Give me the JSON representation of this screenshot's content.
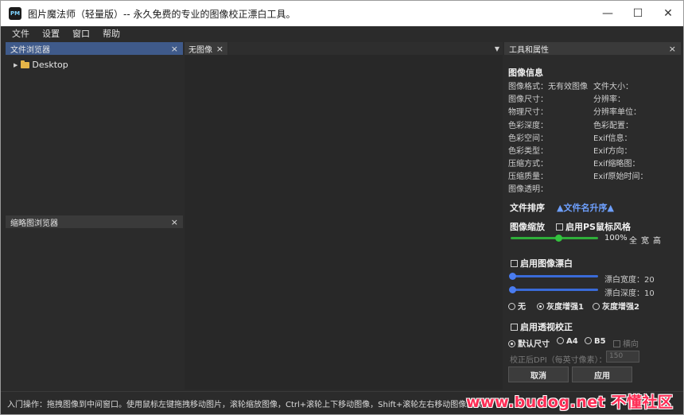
{
  "window": {
    "title": "图片魔法师（轻量版）-- 永久免费的专业的图像校正漂白工具。",
    "app_icon_text": "PM",
    "controls": {
      "minimize": "—",
      "maximize": "☐",
      "close": "✕"
    }
  },
  "menu": [
    "文件",
    "设置",
    "窗口",
    "帮助"
  ],
  "file_browser": {
    "title": "文件浏览器",
    "tree": [
      {
        "label": "Desktop",
        "icon": "folder-icon",
        "expanded": false
      }
    ]
  },
  "thumb_browser": {
    "title": "缩略图浏览器"
  },
  "editor": {
    "tab_label": "无图像"
  },
  "props": {
    "panel_title": "工具和属性",
    "info_title": "图像信息",
    "info_left": [
      "图像格式：无有效图像",
      "图像尺寸：",
      "物理尺寸：",
      "色彩深度：",
      "色彩空间：",
      "色彩类型：",
      "压缩方式：",
      "压缩质量：",
      "图像透明："
    ],
    "info_right": [
      "文件大小：",
      "分辨率：",
      "分辨率单位：",
      "色彩配置：",
      "Exif信息：",
      "Exif方向：",
      "Exif缩略图：",
      "Exif原始时间："
    ],
    "sort_label": "文件排序",
    "sort_value": "▲文件名升序▲",
    "zoom_label": "图像缩放",
    "ps_style_label": "启用PS鼠标风格",
    "zoom_value": "100%",
    "zoom_fraction": 0.55,
    "zoom_buttons": [
      "全",
      "宽",
      "高"
    ],
    "whiten_label": "启用图像漂白",
    "whiten_width_label": "漂白宽度：20",
    "whiten_depth_label": "漂白深度：10",
    "whiten_width_fraction": 0.0,
    "whiten_depth_fraction": 0.0,
    "gray_options": [
      "无",
      "灰度增强1",
      "灰度增强2"
    ],
    "gray_selected": 1,
    "perspective_label": "启用透视校正",
    "size_options": [
      "默认尺寸",
      "A4",
      "B5"
    ],
    "size_selected": 0,
    "landscape_label": "横向",
    "dpi_label": "校正后DPI（每英寸像素）：",
    "dpi_value": "150",
    "cancel_label": "取消",
    "apply_label": "应用"
  },
  "statusbar": {
    "text": "入门操作：拖拽图像到中间窗口。使用鼠标左键拖拽移动图片，滚轮缩放图像，Ctrl+滚轮上下移动图像，Shift+滚轮左右移动图像。双击"
  },
  "watermark": {
    "text": "www.budog.net 不懂社区"
  },
  "colors": {
    "background": "#2b2b2b",
    "active_header": "#3f5a8a",
    "accent_blue": "#6ea0ff",
    "zoom_slider": "#2fae3a",
    "whiten_slider": "#3a6bd8",
    "watermark": "#ff2d55"
  }
}
